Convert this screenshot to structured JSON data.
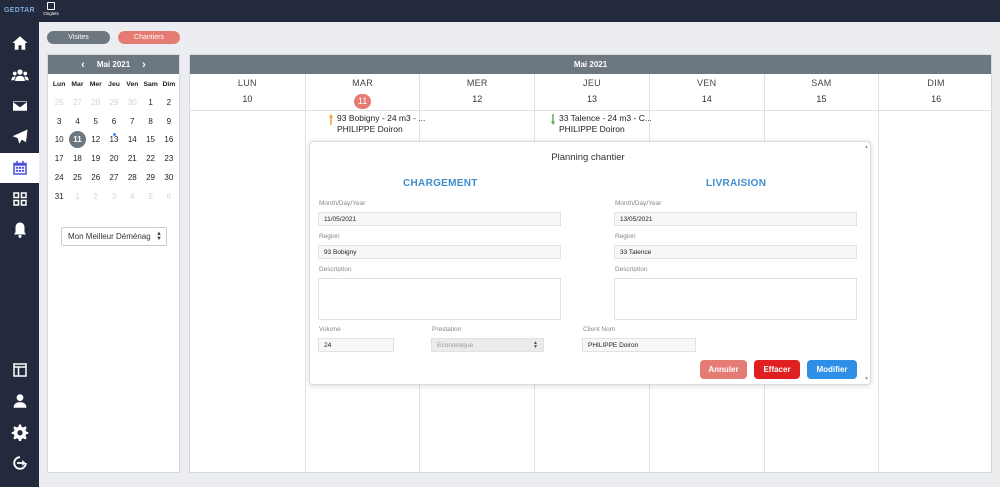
{
  "app": {
    "logo": "GEDTAR",
    "onglets_label": "Onglets"
  },
  "filters": {
    "visites": "Visites",
    "chantiers": "Chantiers"
  },
  "colors": {
    "sidebar": "#232a3d",
    "header_gray": "#6c7780",
    "accent_salmon": "#e57c73",
    "accent_blue": "#3e8ed0",
    "danger": "#e02020",
    "primary": "#2d8fe5"
  },
  "mini_calendar": {
    "title": "Mai 2021",
    "dow": [
      "Lun",
      "Mar",
      "Mer",
      "Jeu",
      "Ven",
      "Sam",
      "Dim"
    ],
    "weeks": [
      [
        "26",
        "27",
        "28",
        "29",
        "30",
        "1",
        "2"
      ],
      [
        "3",
        "4",
        "5",
        "6",
        "7",
        "8",
        "9"
      ],
      [
        "10",
        "11",
        "12",
        "13",
        "14",
        "15",
        "16"
      ],
      [
        "17",
        "18",
        "19",
        "20",
        "21",
        "22",
        "23"
      ],
      [
        "24",
        "25",
        "26",
        "27",
        "28",
        "29",
        "30"
      ],
      [
        "31",
        "1",
        "2",
        "3",
        "4",
        "5",
        "6"
      ]
    ],
    "selected_day": "11",
    "event_dot_day": "13",
    "select_value": "Mon Meilleur Déménag"
  },
  "main_calendar": {
    "title": "Mai 2021",
    "days": [
      {
        "name": "LUN",
        "num": "10"
      },
      {
        "name": "MAR",
        "num": "11"
      },
      {
        "name": "MER",
        "num": "12"
      },
      {
        "name": "JEU",
        "num": "13"
      },
      {
        "name": "VEN",
        "num": "14"
      },
      {
        "name": "SAM",
        "num": "15"
      },
      {
        "name": "DIM",
        "num": "16"
      }
    ],
    "today_index": 1,
    "events": [
      {
        "line1": "93 Bobigny - 24 m3 - ...",
        "line2": "PHILIPPE Doiron",
        "arrow": "up",
        "arrow_color": "#f0a020"
      },
      {
        "line1": "33 Talence - 24 m3 - C...",
        "line2": "PHILIPPE Doiron",
        "arrow": "down",
        "arrow_color": "#4caf50"
      }
    ]
  },
  "modal": {
    "title": "Planning chantier",
    "chargement": {
      "title": "CHARGEMENT",
      "date_label": "Month/Day/Year",
      "date_value": "11/05/2021",
      "region_label": "Region",
      "region_value": "93 Bobigny",
      "description_label": "Description",
      "description_value": ""
    },
    "livraison": {
      "title": "LIVRAISION",
      "date_label": "Month/Day/Year",
      "date_value": "13/05/2021",
      "region_label": "Region",
      "region_value": "33 Talence",
      "description_label": "Description",
      "description_value": ""
    },
    "volume_label": "Volume",
    "volume_value": "24",
    "prestation_label": "Prestation",
    "prestation_value": "Economique",
    "client_label": "Client Nom",
    "client_value": "PHILIPPE  Doiron",
    "buttons": {
      "annuler": "Annuler",
      "effacer": "Effacer",
      "modifier": "Modifier"
    }
  }
}
